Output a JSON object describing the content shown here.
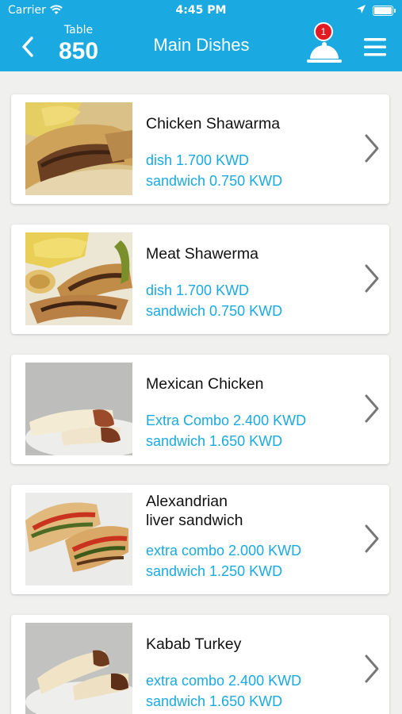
{
  "status_bar": {
    "carrier": "Carrier",
    "time": "4:45 PM"
  },
  "nav": {
    "table_label": "Table",
    "table_number": "850",
    "title": "Main Dishes",
    "cart_count": "1"
  },
  "items": [
    {
      "name": "Chicken Shawarma",
      "price1": "dish 1.700 KWD",
      "price2": "sandwich 0.750 KWD",
      "image": "shawarma-wrap-chips"
    },
    {
      "name": "Meat Shawerma",
      "price1": "dish 1.700 KWD",
      "price2": "sandwich 0.750 KWD",
      "image": "meat-shawarma-wraps"
    },
    {
      "name": "Mexican Chicken",
      "price1": "Extra Combo 2.400 KWD",
      "price2": "sandwich 1.650 KWD",
      "image": "tortilla-wraps-plate"
    },
    {
      "name": "Alexandrian\nliver sandwich",
      "price1": "extra combo 2.000 KWD",
      "price2": "sandwich 1.250 KWD",
      "image": "liver-sandwich"
    },
    {
      "name": "Kabab Turkey",
      "price1": "extra combo 2.400 KWD",
      "price2": "sandwich 1.650 KWD",
      "image": "kabab-wraps-plate"
    }
  ],
  "colors": {
    "primary": "#1aa9e0",
    "badge": "#e21b23",
    "background": "#f0f0ee"
  }
}
